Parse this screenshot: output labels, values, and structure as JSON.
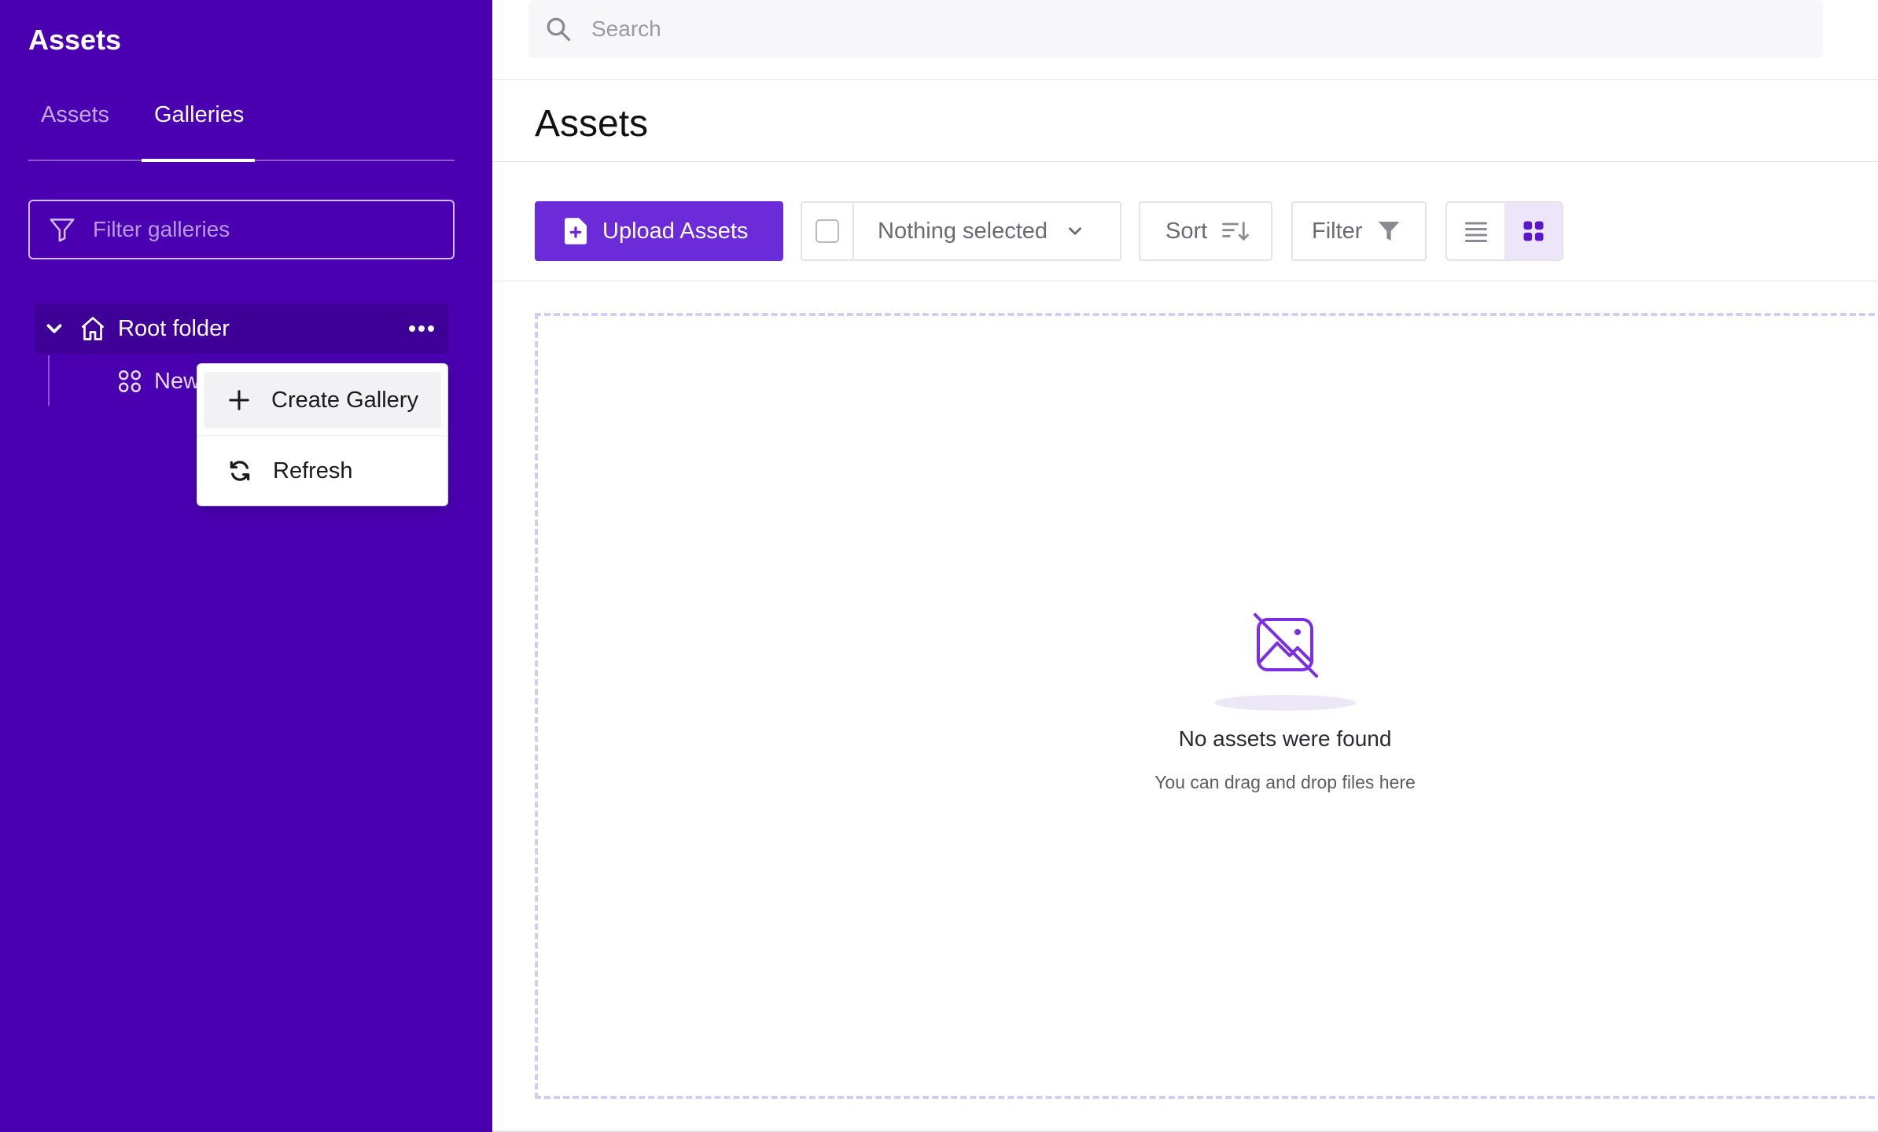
{
  "sidebar": {
    "title": "Assets",
    "tabs": [
      {
        "label": "Assets",
        "active": false
      },
      {
        "label": "Galleries",
        "active": true
      }
    ],
    "filter": {
      "placeholder": "Filter galleries",
      "value": ""
    },
    "tree": {
      "root": {
        "label": "Root folder",
        "expanded": true
      },
      "children": [
        {
          "label": "New"
        }
      ]
    }
  },
  "context_menu": {
    "items": [
      {
        "label": "Create Gallery",
        "icon": "plus-icon",
        "highlighted": true
      },
      {
        "label": "Refresh",
        "icon": "refresh-icon",
        "highlighted": false
      }
    ]
  },
  "topbar": {
    "search": {
      "placeholder": "Search",
      "value": ""
    }
  },
  "page": {
    "title": "Assets"
  },
  "toolbar": {
    "upload_label": "Upload Assets",
    "selection_label": "Nothing selected",
    "sort_label": "Sort",
    "filter_label": "Filter",
    "view_mode": "grid"
  },
  "empty_state": {
    "title": "No assets were found",
    "subtitle": "You can drag and drop files here",
    "icon": "image-off-icon"
  },
  "colors": {
    "sidebar_bg": "#4a00b0",
    "accent": "#6b2bd9",
    "active_view_bg": "#ede6fb",
    "dropzone_border": "#d6ccf2"
  }
}
